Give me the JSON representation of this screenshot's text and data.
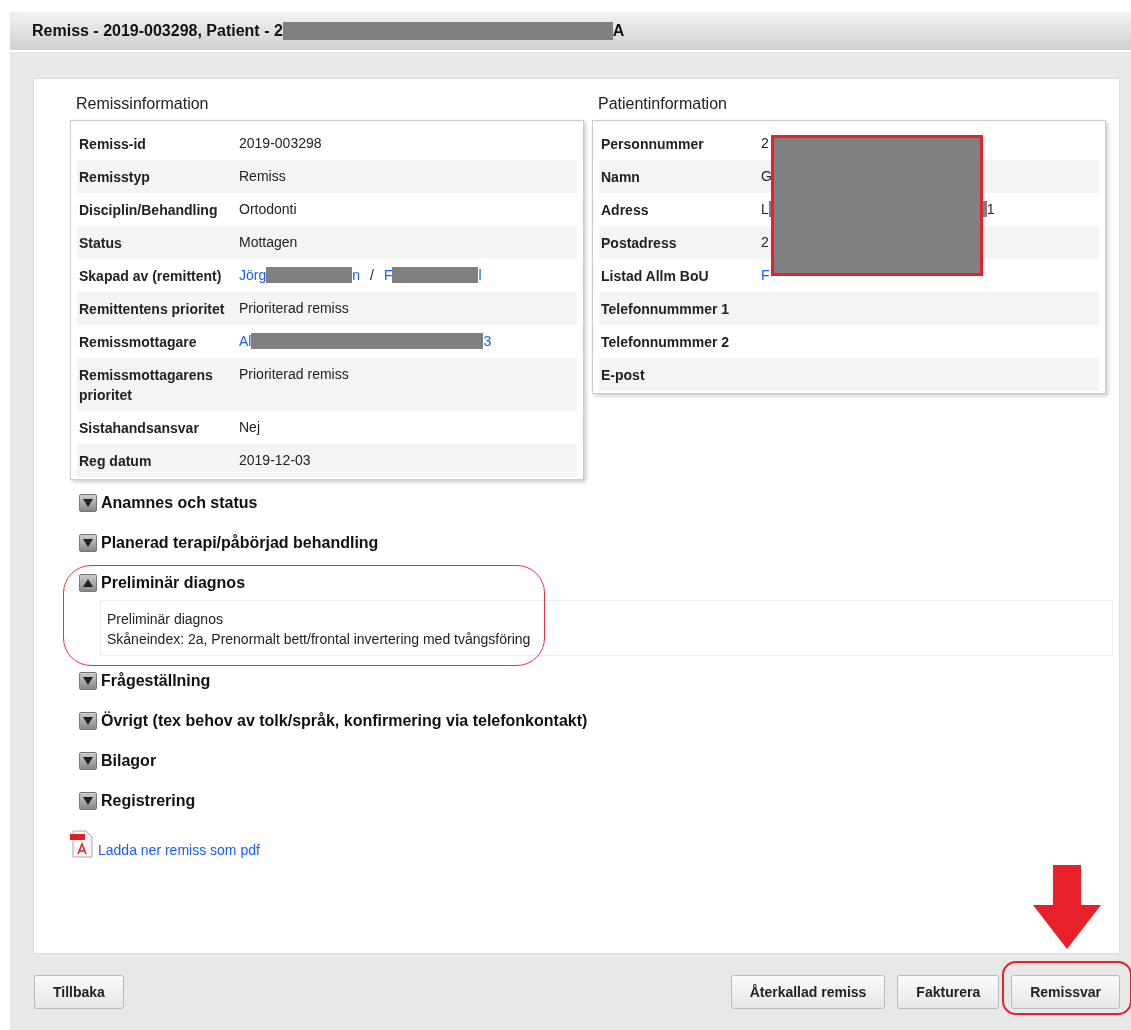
{
  "window": {
    "title_start": "Remiss - 2019-003298, Patient - 2",
    "title_end": "A"
  },
  "referral": {
    "heading": "Remissinformation",
    "rows": [
      {
        "label": "Remiss-id",
        "value": [
          {
            "kind": "text",
            "text": "2019-003298"
          }
        ]
      },
      {
        "label": "Remisstyp",
        "value": [
          {
            "kind": "text",
            "text": "Remiss"
          }
        ]
      },
      {
        "label": "Disciplin/Behandling",
        "value": [
          {
            "kind": "text",
            "text": "Ortodonti"
          }
        ]
      },
      {
        "label": "Status",
        "value": [
          {
            "kind": "text",
            "text": "Mottagen"
          }
        ]
      },
      {
        "label": "Skapad av (remittent)",
        "value": [
          {
            "kind": "link",
            "text": "Jörg"
          },
          {
            "kind": "redaction"
          },
          {
            "kind": "link",
            "text": "n"
          },
          {
            "kind": "separator",
            "text": "/"
          },
          {
            "kind": "link",
            "text": "F"
          },
          {
            "kind": "redaction"
          },
          {
            "kind": "link",
            "text": "l"
          }
        ]
      },
      {
        "label": "Remittentens prioritet",
        "value": [
          {
            "kind": "text",
            "text": "Prioriterad remiss"
          }
        ]
      },
      {
        "label": "Remissmottagare",
        "value": [
          {
            "kind": "link",
            "text": "Al"
          },
          {
            "kind": "wide_redaction"
          },
          {
            "kind": "link",
            "text": "3"
          }
        ]
      },
      {
        "label": "Remissmottagarens prioritet",
        "value": [
          {
            "kind": "text",
            "text": "Prioriterad remiss"
          }
        ]
      },
      {
        "label": "Sistahandsansvar",
        "value": [
          {
            "kind": "text",
            "text": "Nej"
          }
        ]
      },
      {
        "label": "Reg datum",
        "value": [
          {
            "kind": "text",
            "text": "2019-12-03"
          }
        ]
      }
    ]
  },
  "patient": {
    "heading": "Patientinformation",
    "rows": [
      {
        "label": "Personnummer",
        "value": [
          {
            "kind": "text",
            "text": "2"
          }
        ]
      },
      {
        "label": "Namn",
        "value": [
          {
            "kind": "text",
            "text": "G"
          }
        ]
      },
      {
        "label": "Adress",
        "value": [
          {
            "kind": "text",
            "text": "L"
          },
          {
            "kind": "wide_redaction"
          },
          {
            "kind": "text",
            "text": "1"
          }
        ]
      },
      {
        "label": "Postadress",
        "value": [
          {
            "kind": "text",
            "text": "2"
          }
        ]
      },
      {
        "label": "Listad Allm BoU",
        "value": [
          {
            "kind": "link",
            "text": "F"
          }
        ]
      },
      {
        "label": "Telefonnummmer 1",
        "value": []
      },
      {
        "label": "Telefonnummmer 2",
        "value": []
      },
      {
        "label": "E-post",
        "value": []
      }
    ]
  },
  "sections": [
    {
      "title": "Anamnes och status",
      "expanded": false
    },
    {
      "title": "Planerad terapi/påbörjad behandling",
      "expanded": false
    },
    {
      "title": "Preliminär diagnos",
      "expanded": true,
      "circled": true,
      "content": [
        "Preliminär diagnos",
        "Skåneindex: 2a, Prenormalt bett/frontal invertering med tvångsföring"
      ]
    },
    {
      "title": "Frågeställning",
      "expanded": false
    },
    {
      "title": "Övrigt (tex behov av tolk/språk, konfirmering via telefonkontakt)",
      "expanded": false
    },
    {
      "title": "Bilagor",
      "expanded": false
    },
    {
      "title": "Registrering",
      "expanded": false
    }
  ],
  "pdf_link": "Ladda ner remiss som pdf",
  "footer": {
    "left_buttons": [
      {
        "label": "Tillbaka"
      }
    ],
    "right_buttons": [
      {
        "label": "Återkallad remiss"
      },
      {
        "label": "Fakturera"
      },
      {
        "label": "Remissvar",
        "circled": true
      }
    ]
  }
}
